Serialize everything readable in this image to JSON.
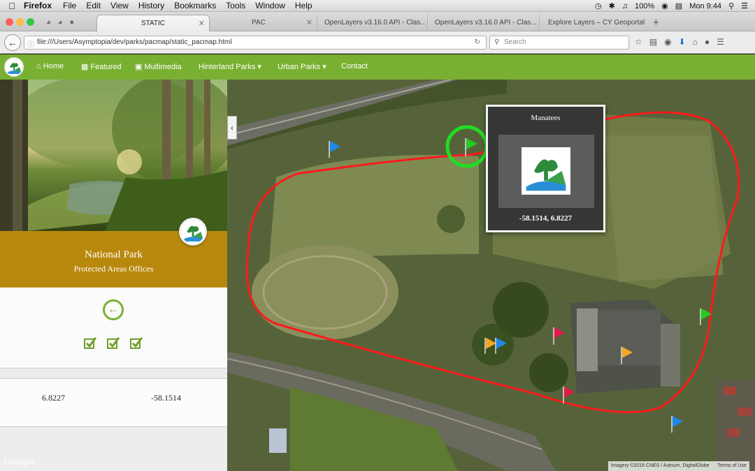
{
  "menubar": {
    "app": "Firefox",
    "menus": [
      "File",
      "Edit",
      "View",
      "History",
      "Bookmarks",
      "Tools",
      "Window",
      "Help"
    ],
    "battery": "100%",
    "clock": "Mon 9:44"
  },
  "tabs": [
    {
      "label": "STATIC",
      "active": true
    },
    {
      "label": "PAC"
    },
    {
      "label": "OpenLayers v3.16.0 API - Clas..."
    },
    {
      "label": "OpenLayers v3.16.0 API - Clas..."
    },
    {
      "label": "Explore Layers – CY Geoportal"
    }
  ],
  "browser": {
    "url": "file:///Users/Asymptopia/dev/parks/pacmap/static_pacmap.html",
    "search_placeholder": "Search"
  },
  "site_nav": {
    "items": [
      "Home",
      "Featured",
      "Multimedia",
      "Hinterland Parks ▾",
      "Urban Parks ▾",
      "Contact"
    ]
  },
  "sidebar": {
    "title": "National Park",
    "subtitle": "Protected Areas Offices",
    "coord_lat": "6.8227",
    "coord_lon": "-58.1514",
    "google": "Google"
  },
  "popup": {
    "title": "Manatees",
    "coords": "-58.1514, 6.8227"
  },
  "map": {
    "attribution": "Imagery ©2016 CNES / Astrium, DigitalGlobe",
    "terms": "Terms of Use"
  },
  "colors": {
    "nav_green": "#7ab032",
    "gold": "#b8880c",
    "route_red": "#ff1a1a",
    "highlight_green": "#22dd22"
  }
}
